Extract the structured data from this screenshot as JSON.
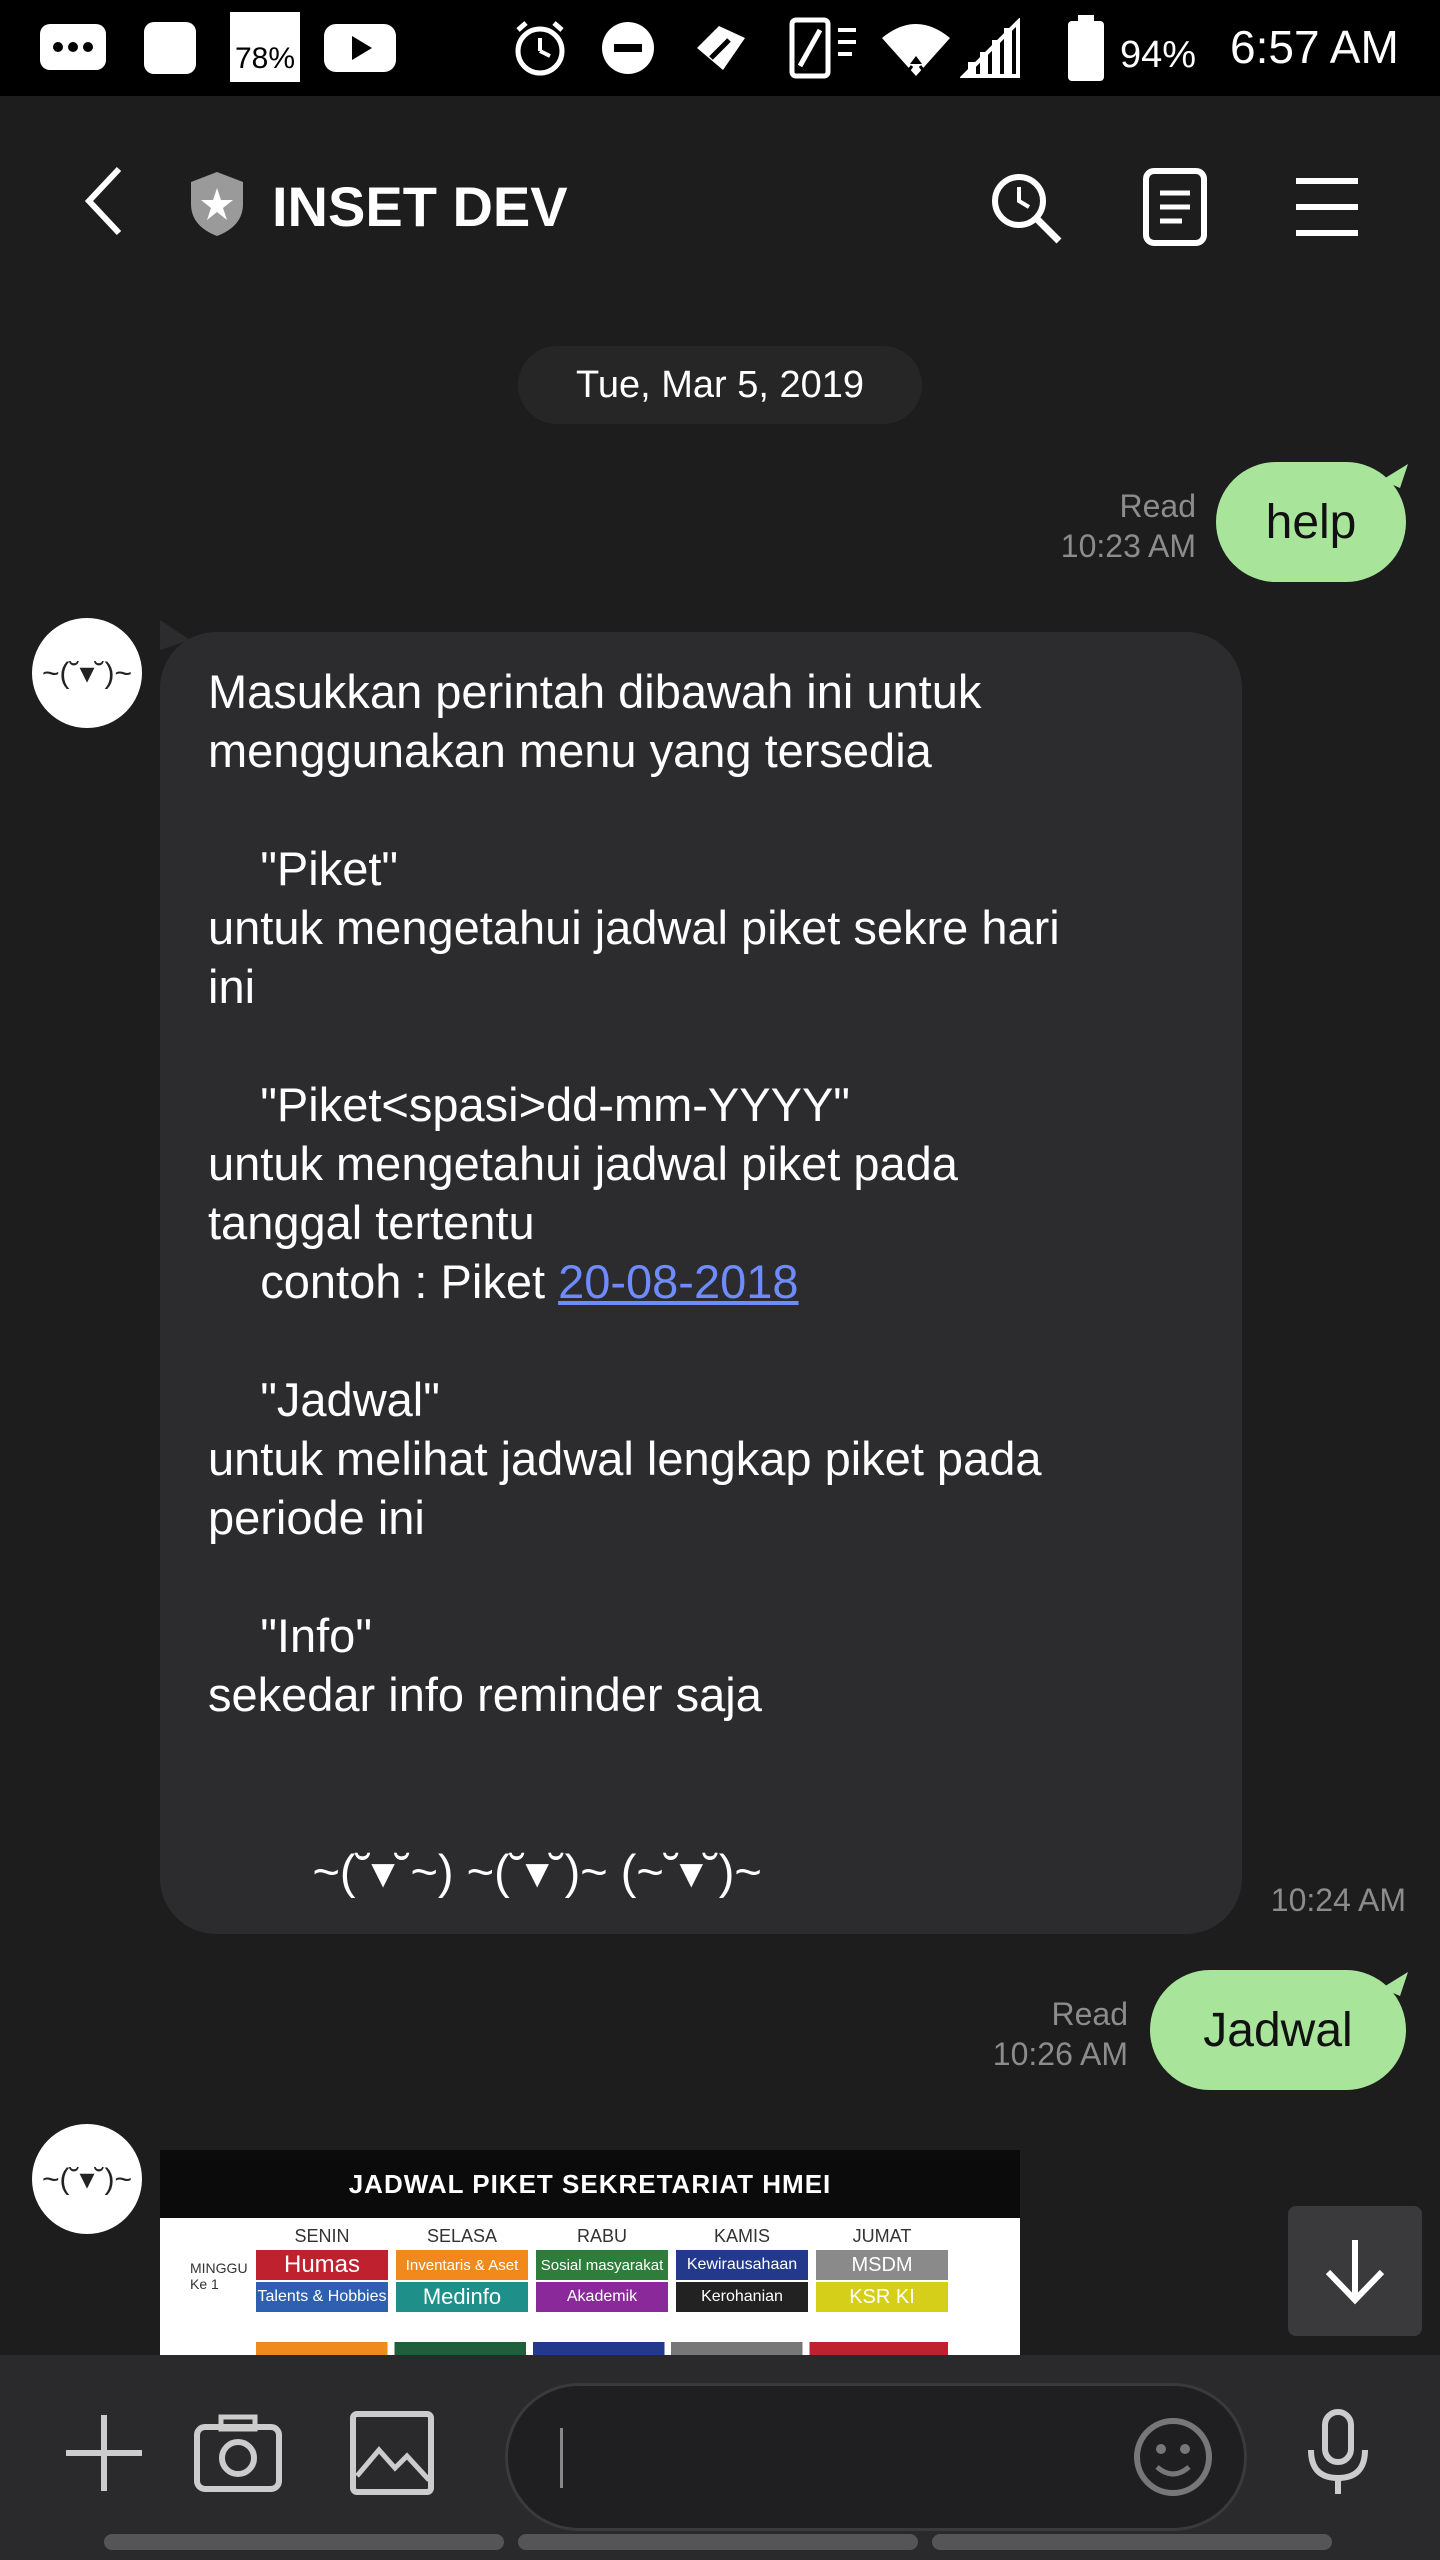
{
  "status_bar": {
    "battery_badge": "78%",
    "battery_percent": "94%",
    "time": "6:57 AM"
  },
  "header": {
    "title": "INSET DEV"
  },
  "date_separator": "Tue, Mar 5, 2019",
  "messages": [
    {
      "text": "help",
      "status": "Read",
      "time": "10:23 AM"
    },
    {
      "avatar": "~(˘▾˘)~",
      "line1": "Masukkan perintah dibawah ini untuk\nmenggunakan menu yang tersedia\n\n    \"Piket\"\nuntuk mengetahui jadwal piket sekre hari\nini\n\n    \"Piket<spasi>dd-mm-YYYY\"\nuntuk mengetahui jadwal piket pada\ntanggal tertentu\n    contoh : Piket ",
      "link": "20-08-2018",
      "line2": "\n\n    \"Jadwal\"\nuntuk melihat jadwal lengkap piket pada\nperiode ini\n\n    \"Info\"\nsekedar info reminder saja\n\n\n        ~(˘▾˘~) ~(˘▾˘)~ (~˘▾˘)~",
      "time": "10:24 AM"
    },
    {
      "text": "Jadwal",
      "status": "Read",
      "time": "10:26 AM"
    },
    {
      "avatar": "~(˘▾˘)~",
      "image": {
        "title": "JADWAL PIKET SEKRETARIAT HMEI",
        "row_label": "MINGGU Ke 1",
        "days": [
          "SENIN",
          "SELASA",
          "RABU",
          "KAMIS",
          "JUMAT"
        ],
        "row1": [
          "Humas",
          "Inventaris & Aset",
          "Sosial masyarakat",
          "Kewirausahaan",
          "MSDM"
        ],
        "row2": [
          "Talents & Hobbies",
          "Medinfo",
          "Akademik",
          "Kerohanian",
          "KSR KI"
        ],
        "row1_colors": [
          "#c0212e",
          "#f08a1c",
          "#2f7d3a",
          "#233a8c",
          "#8a8a8a"
        ],
        "row2_colors": [
          "#2f5fb0",
          "#1f8f8a",
          "#8a2a9a",
          "#222222",
          "#d6cf1a"
        ]
      }
    }
  ],
  "colors": {
    "background": "#1d1d1e",
    "outgoing_bubble": "#a8e59a",
    "incoming_bubble": "#2c2c2e",
    "link": "#6e8cff"
  }
}
